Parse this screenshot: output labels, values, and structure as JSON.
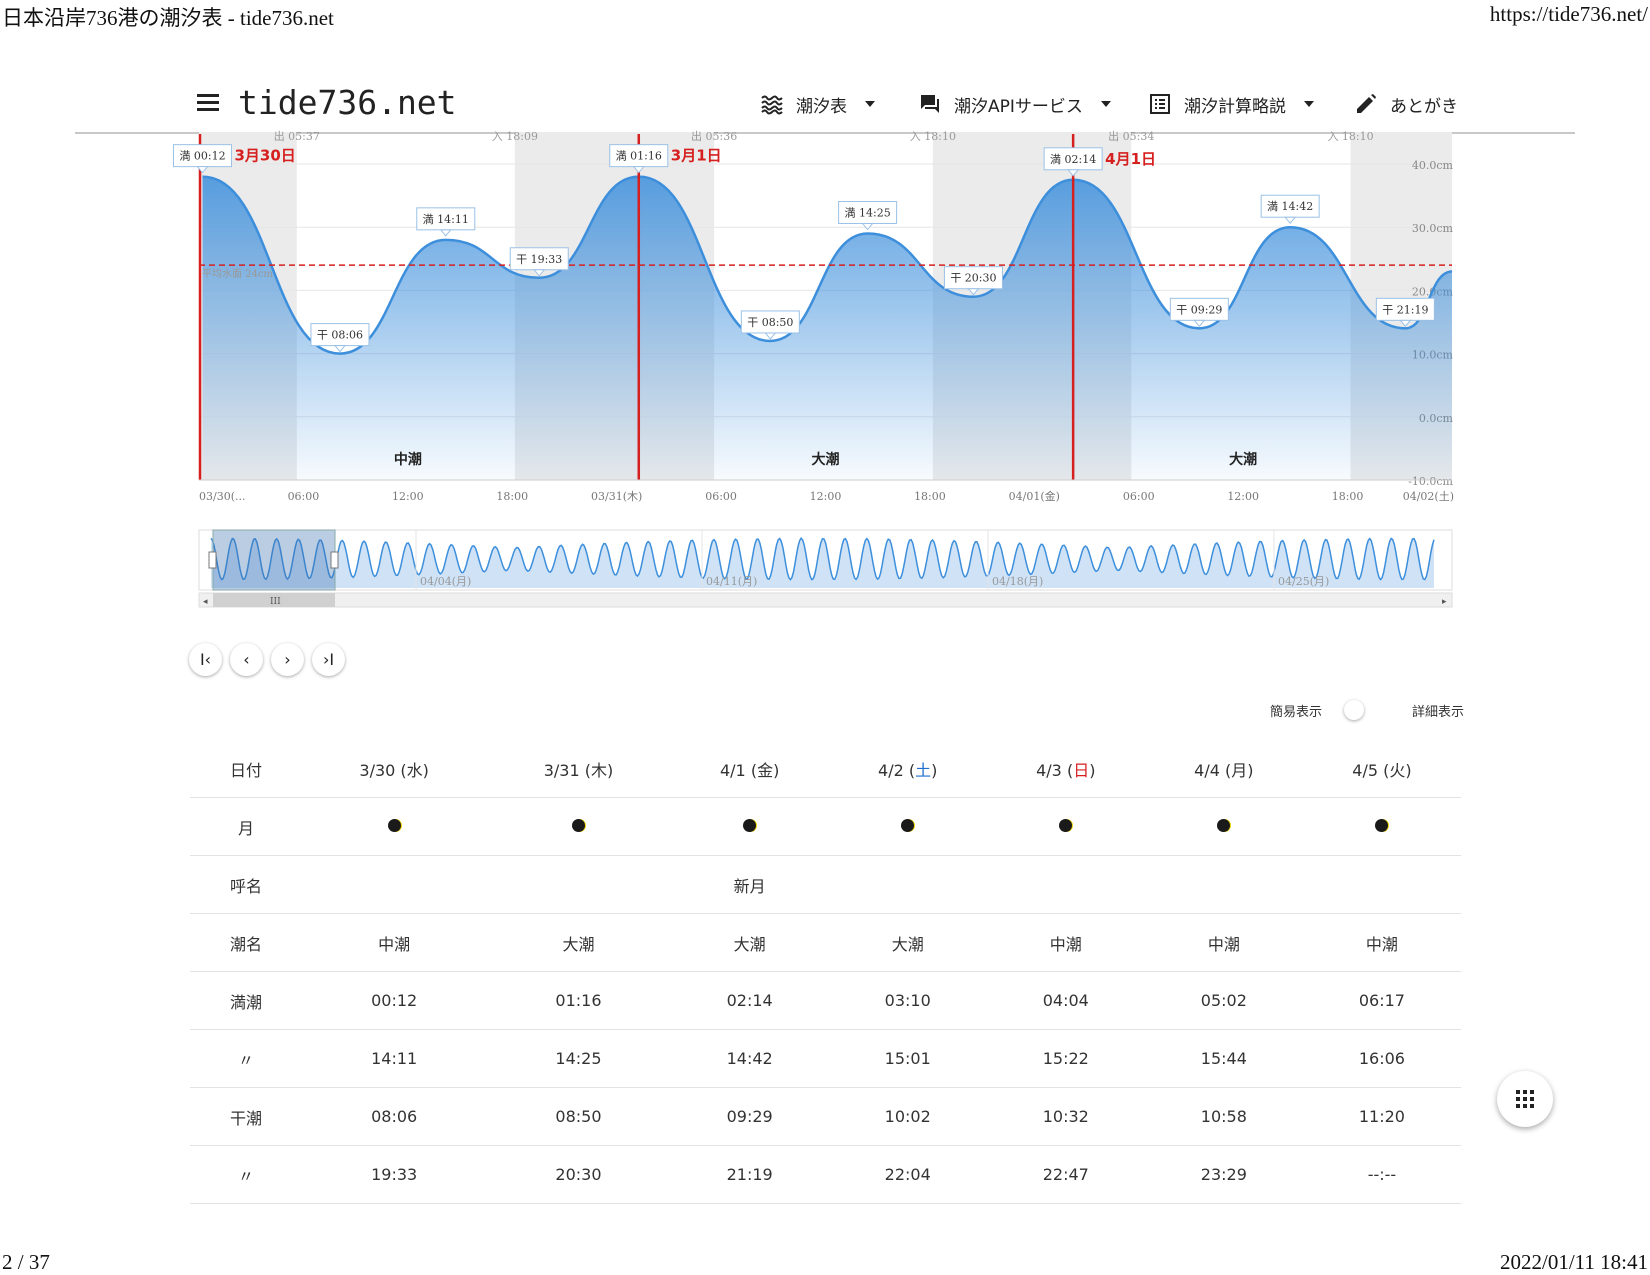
{
  "print_header": {
    "title": "日本沿岸736港の潮汐表 - tide736.net",
    "url": "https://tide736.net/"
  },
  "print_footer": {
    "page": "2 / 37",
    "timestamp": "2022/01/11 18:41"
  },
  "nav": {
    "brand": "tide736.net",
    "items": [
      {
        "label": "潮汐表",
        "icon": "waves-icon",
        "has_caret": true
      },
      {
        "label": "潮汐APIサービス",
        "icon": "chat-icon",
        "has_caret": true
      },
      {
        "label": "潮汐計算略説",
        "icon": "list-icon",
        "has_caret": true
      },
      {
        "label": "あとがき",
        "icon": "pencil-icon",
        "has_caret": false
      }
    ]
  },
  "chart_data": {
    "type": "area",
    "unit": "cm",
    "y_ticks": [
      "40.0cm",
      "30.0cm",
      "20.0cm",
      "10.0cm",
      "0.0cm",
      "-10.0cm"
    ],
    "ylim": [
      -10,
      40
    ],
    "x_tick_labels": [
      "03/30(...",
      "06:00",
      "12:00",
      "18:00",
      "03/31(木)",
      "06:00",
      "12:00",
      "18:00",
      "04/01(金)",
      "06:00",
      "12:00",
      "18:00",
      "04/02(土)"
    ],
    "xlim_hours": [
      0,
      72
    ],
    "mean_level_label": "平均水面 24cm",
    "mean_level": 24,
    "sun_labels": [
      "出 05:37",
      "入 18:09",
      "出 05:36",
      "入 18:10",
      "出 05:34",
      "入 18:10"
    ],
    "sun_hours": [
      5.62,
      18.15,
      29.6,
      42.17,
      53.57,
      66.17
    ],
    "extremes": [
      {
        "label": "満 00:12",
        "h": 0.2,
        "v": 38
      },
      {
        "label": "干 08:06",
        "h": 8.1,
        "v": 10
      },
      {
        "label": "満 14:11",
        "h": 14.18,
        "v": 28
      },
      {
        "label": "干 19:33",
        "h": 19.55,
        "v": 22
      },
      {
        "label": "満 01:16",
        "h": 25.27,
        "v": 38
      },
      {
        "label": "干 08:50",
        "h": 32.83,
        "v": 12
      },
      {
        "label": "満 14:25",
        "h": 38.42,
        "v": 29
      },
      {
        "label": "干 20:30",
        "h": 44.5,
        "v": 19
      },
      {
        "label": "満 02:14",
        "h": 50.23,
        "v": 37.5
      },
      {
        "label": "干 09:29",
        "h": 57.48,
        "v": 14
      },
      {
        "label": "満 14:42",
        "h": 62.7,
        "v": 30
      },
      {
        "label": "干 21:19",
        "h": 69.32,
        "v": 14
      },
      {
        "label": "",
        "h": 72,
        "v": 23
      }
    ],
    "date_markers": [
      {
        "label": "3月30日",
        "h": 0
      },
      {
        "label": "3月1日",
        "h": 25.27
      },
      {
        "label": "4月1日",
        "h": 50.23
      }
    ],
    "tide_names": [
      {
        "label": "中潮",
        "h": 12
      },
      {
        "label": "大潮",
        "h": 36
      },
      {
        "label": "大潮",
        "h": 60
      }
    ],
    "navigator_dates": [
      "04/04(月)",
      "04/11(月)",
      "04/18(月)",
      "04/25(月)"
    ]
  },
  "view_toggle": {
    "simple": "簡易表示",
    "detail": "詳細表示"
  },
  "table": {
    "row_labels": [
      "日付",
      "月",
      "呼名",
      "潮名",
      "満潮",
      "〃",
      "干潮",
      "〃"
    ],
    "days": [
      {
        "d": "3/30",
        "w": "水",
        "wc": ""
      },
      {
        "d": "3/31",
        "w": "木",
        "wc": ""
      },
      {
        "d": "4/1",
        "w": "金",
        "wc": ""
      },
      {
        "d": "4/2",
        "w": "土",
        "wc": "#1f6fd1"
      },
      {
        "d": "4/3",
        "w": "日",
        "wc": "#d61f1f"
      },
      {
        "d": "4/4",
        "w": "月",
        "wc": ""
      },
      {
        "d": "4/5",
        "w": "火",
        "wc": ""
      }
    ],
    "moon_name": [
      "",
      "",
      "新月",
      "",
      "",
      "",
      ""
    ],
    "tide_name": [
      "中潮",
      "大潮",
      "大潮",
      "大潮",
      "中潮",
      "中潮",
      "中潮"
    ],
    "high1": [
      "00:12",
      "01:16",
      "02:14",
      "03:10",
      "04:04",
      "05:02",
      "06:17"
    ],
    "high2": [
      "14:11",
      "14:25",
      "14:42",
      "15:01",
      "15:22",
      "15:44",
      "16:06"
    ],
    "low1": [
      "08:06",
      "08:50",
      "09:29",
      "10:02",
      "10:32",
      "10:58",
      "11:20"
    ],
    "low2": [
      "19:33",
      "20:30",
      "21:19",
      "22:04",
      "22:47",
      "23:29",
      "--:--"
    ]
  },
  "colors": {
    "accent_red": "#d61f1f",
    "tide_blue": "#3d8fdc",
    "weekday_blue": "#1f6fd1"
  }
}
